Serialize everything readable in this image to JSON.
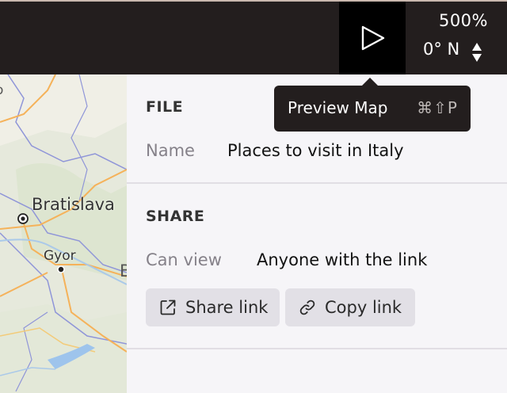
{
  "toolbar": {
    "zoom_level": "500%",
    "heading": "0° N"
  },
  "tooltip": {
    "label": "Preview Map",
    "shortcut": "⌘⇧P"
  },
  "map": {
    "labels": [
      "Bratislava",
      "Gyor"
    ],
    "partial_labels": [
      "o",
      "B"
    ]
  },
  "file_section": {
    "title": "FILE",
    "name_label": "Name",
    "name_value": "Places to visit in Italy"
  },
  "share_section": {
    "title": "SHARE",
    "can_view_label": "Can view",
    "can_view_value": "Anyone with the link",
    "share_link_label": "Share link",
    "copy_link_label": "Copy link"
  }
}
